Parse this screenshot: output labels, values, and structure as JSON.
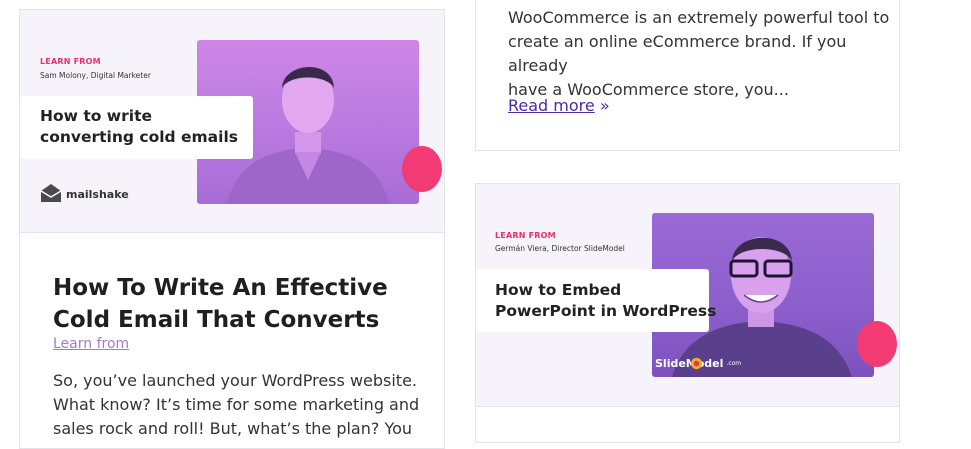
{
  "left_card": {
    "banner": {
      "learn_from": "LEARN FROM",
      "author": "Sam Molony, Digital Marketer",
      "title_line1": "How to write",
      "title_line2": "converting cold emails",
      "brand": "mailshake"
    },
    "post_title": "How To Write An Effective Cold Email That Converts",
    "category": "Learn from",
    "excerpt_lines": [
      "So, you’ve launched your WordPress website.",
      "What know? It’s time for some marketing and",
      "sales rock and roll! But, what’s the plan? You"
    ]
  },
  "right_top_card": {
    "excerpt_lines": [
      "WooCommerce is an extremely powerful tool to",
      "create an online eCommerce brand. If you already",
      "have a WooCommerce store, you..."
    ],
    "read_more": "Read more",
    "read_more_icon": "»"
  },
  "right_bottom_card": {
    "banner": {
      "learn_from": "LEARN FROM",
      "author": "Germán Viera, Director SlideModel",
      "title_line1": "How to Embed",
      "title_line2": "PowerPoint in WordPress",
      "brand": "SlideModel",
      "brand_suffix": ".com"
    }
  },
  "colors": {
    "accent_pink": "#e8306a",
    "photo_purple": "#b97ae0",
    "link_purple": "#4b2aa8"
  }
}
